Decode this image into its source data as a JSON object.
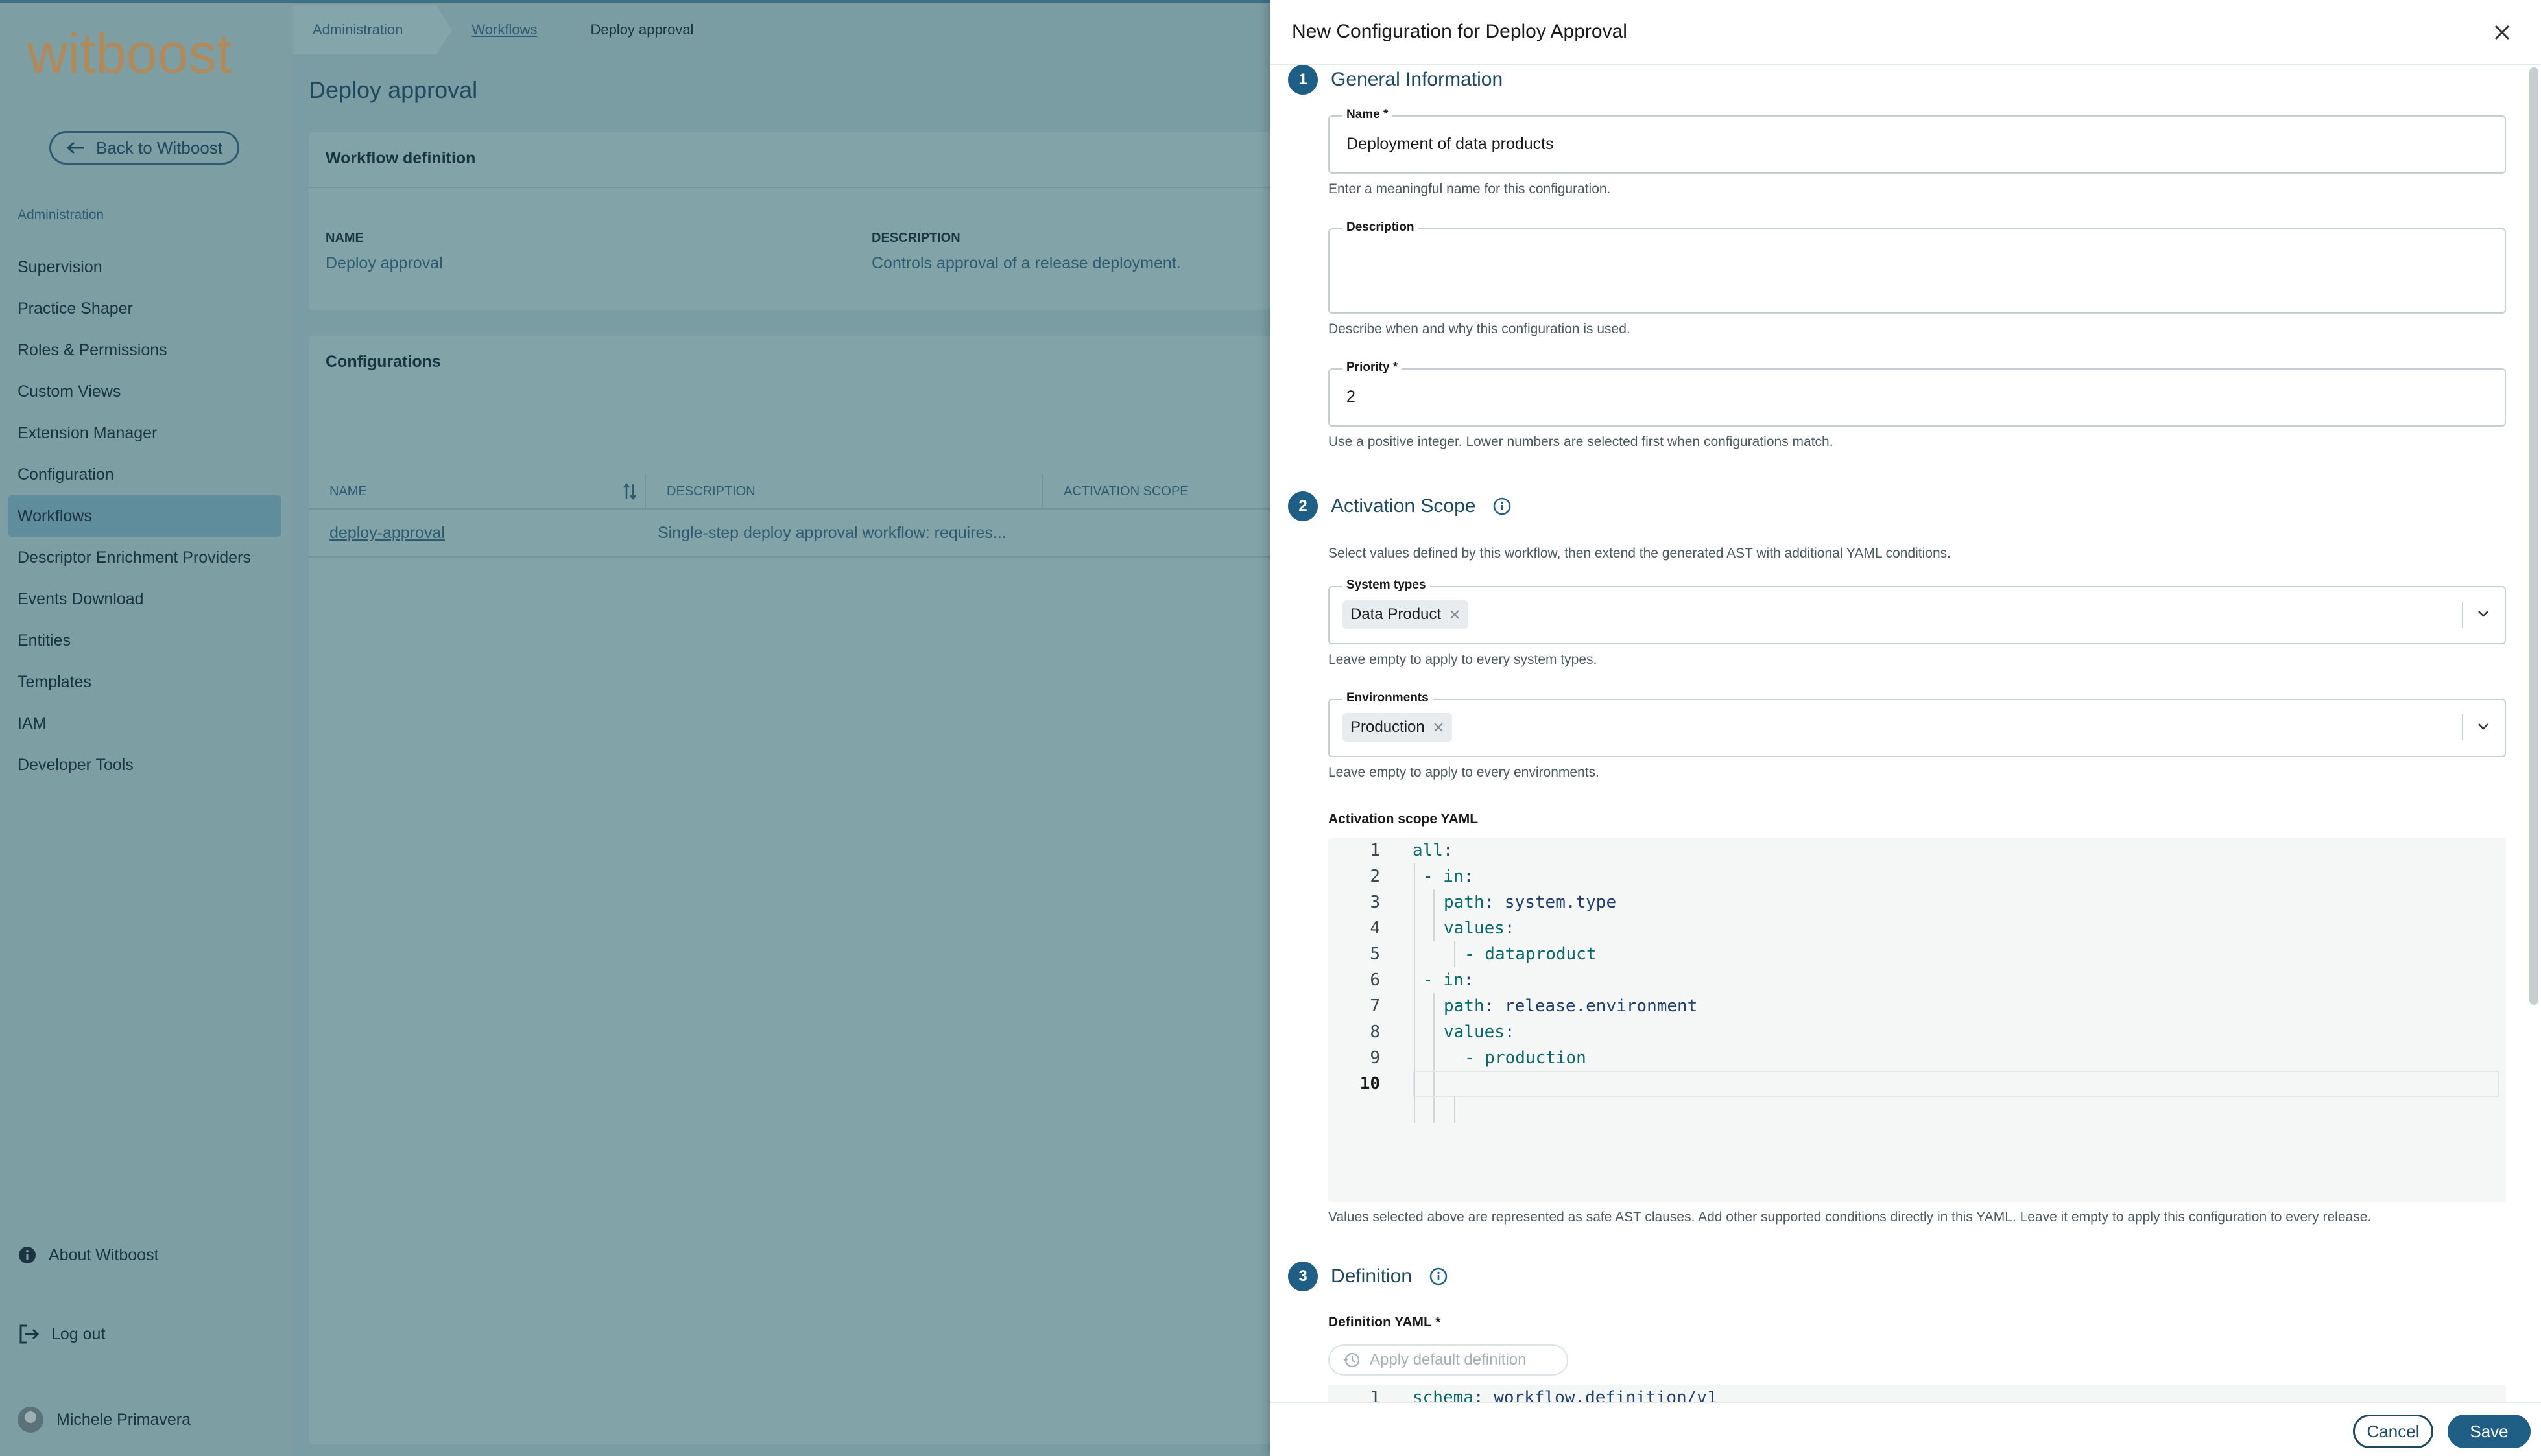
{
  "app": {
    "logo_text": "witboost",
    "back_label": "Back to Witboost",
    "nav_heading": "Administration",
    "nav_items": [
      {
        "label": "Supervision",
        "active": false
      },
      {
        "label": "Practice Shaper",
        "active": false
      },
      {
        "label": "Roles & Permissions",
        "active": false
      },
      {
        "label": "Custom Views",
        "active": false
      },
      {
        "label": "Extension Manager",
        "active": false
      },
      {
        "label": "Configuration",
        "active": false
      },
      {
        "label": "Workflows",
        "active": true
      },
      {
        "label": "Descriptor Enrichment Providers",
        "active": false
      },
      {
        "label": "Events Download",
        "active": false
      },
      {
        "label": "Entities",
        "active": false
      },
      {
        "label": "Templates",
        "active": false
      },
      {
        "label": "IAM",
        "active": false
      },
      {
        "label": "Developer Tools",
        "active": false
      }
    ],
    "about_label": "About Witboost",
    "logout_label": "Log out",
    "user_name": "Michele Primavera"
  },
  "breadcrumb": [
    "Administration",
    "Workflows",
    "Deploy approval"
  ],
  "page": {
    "title": "Deploy approval",
    "workflow_card": {
      "title": "Workflow definition",
      "name_label": "NAME",
      "name_value": "Deploy approval",
      "description_label": "DESCRIPTION",
      "description_value": "Controls approval of a release deployment."
    },
    "configurations": {
      "title": "Configurations",
      "columns": [
        "NAME",
        "DESCRIPTION",
        "ACTIVATION SCOPE"
      ],
      "rows": [
        {
          "name": "deploy-approval",
          "description": "Single-step deploy approval workflow: requires..."
        }
      ]
    }
  },
  "drawer": {
    "title": "New Configuration for Deploy Approval",
    "general": {
      "step": "1",
      "title": "General Information",
      "name_label": "Name *",
      "name_value": "Deployment of data products",
      "name_helper": "Enter a meaningful name for this configuration.",
      "description_label": "Description",
      "description_value": "",
      "description_helper": "Describe when and why this configuration is used.",
      "priority_label": "Priority *",
      "priority_value": "2",
      "priority_helper": "Use a positive integer. Lower numbers are selected first when configurations match."
    },
    "activation": {
      "step": "2",
      "title": "Activation Scope",
      "intro": "Select values defined by this workflow, then extend the generated AST with additional YAML conditions.",
      "system_types_label": "System types",
      "system_types_chip": "Data Product",
      "system_types_helper": "Leave empty to apply to every system types.",
      "environments_label": "Environments",
      "environments_chip": "Production",
      "environments_helper": "Leave empty to apply to every environments.",
      "yaml_label": "Activation scope YAML",
      "yaml_lines": [
        {
          "n": "1",
          "key": "all",
          "rest": ":"
        },
        {
          "n": "2",
          "key": "- in",
          "rest": ":"
        },
        {
          "n": "3",
          "key": "path",
          "rest": ": system.type"
        },
        {
          "n": "4",
          "key": "values",
          "rest": ":"
        },
        {
          "n": "5",
          "key": "- dataproduct",
          "rest": ""
        },
        {
          "n": "6",
          "key": "- in",
          "rest": ":"
        },
        {
          "n": "7",
          "key": "path",
          "rest": ": release.environment"
        },
        {
          "n": "8",
          "key": "values",
          "rest": ":"
        },
        {
          "n": "9",
          "key": "- production",
          "rest": ""
        },
        {
          "n": "10",
          "key": "",
          "rest": ""
        }
      ],
      "yaml_helper": "Values selected above are represented as safe AST clauses. Add other supported conditions directly in this YAML. Leave it empty to apply this configuration to every release."
    },
    "definition": {
      "step": "3",
      "title": "Definition",
      "yaml_label": "Definition YAML *",
      "apply_default_label": "Apply default definition",
      "first_line_number": "1",
      "first_line_key": "schema",
      "first_line_rest": ": workflow.definition/v1"
    },
    "cancel_label": "Cancel",
    "save_label": "Save"
  },
  "colors": {
    "accent": "#1f5f86",
    "overlay": "#7a9ca3"
  }
}
